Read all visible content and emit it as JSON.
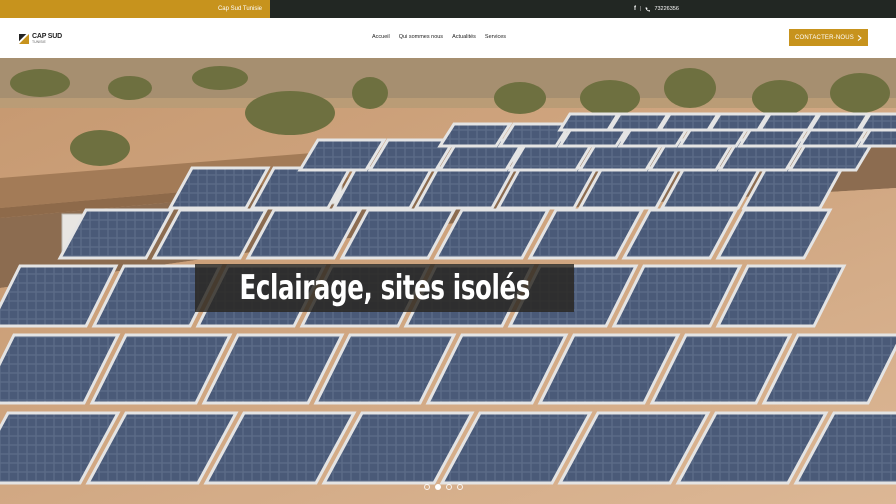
{
  "topbar": {
    "brand": "Cap Sud Tunisie",
    "facebook_icon": "f",
    "phone_icon": "phone-icon",
    "phone": "73226356"
  },
  "header": {
    "logo": {
      "main": "CAP SUD",
      "sub": "TUNISIE"
    },
    "nav": [
      {
        "label": "Accueil"
      },
      {
        "label": "Qui sommes nous"
      },
      {
        "label": "Actualités"
      },
      {
        "label": "Services"
      }
    ],
    "cta": {
      "label": "CONTACTER-NOUS",
      "icon": "chevron-right-icon"
    }
  },
  "hero": {
    "caption": "Eclairage, sites isolés",
    "slides": [
      {
        "active": false
      },
      {
        "active": true
      },
      {
        "active": false
      },
      {
        "active": false
      }
    ]
  },
  "colors": {
    "accent": "#c7931d",
    "topbar": "#222723"
  }
}
